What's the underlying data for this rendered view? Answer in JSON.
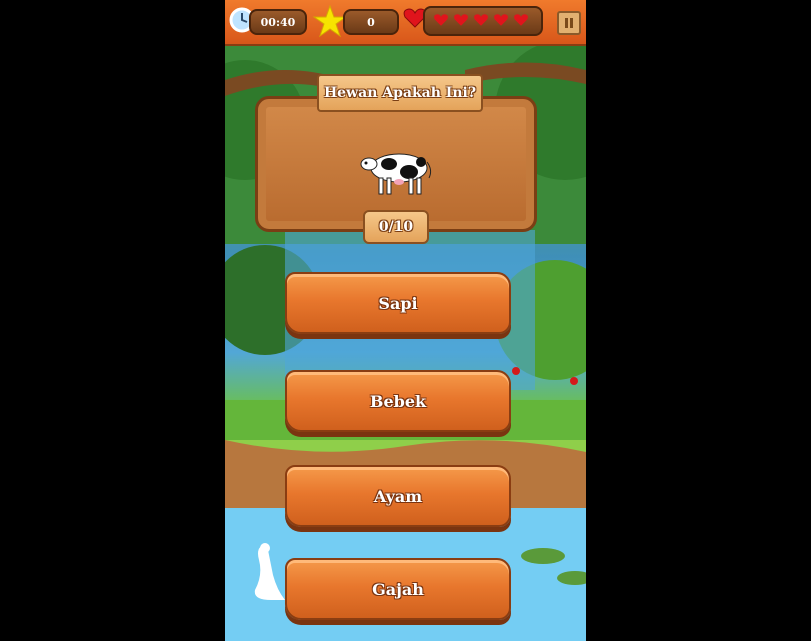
{
  "hud": {
    "timer": "00:40",
    "score": "0",
    "lives": 5,
    "pause_icon": "pause-icon"
  },
  "question": {
    "title": "Hewan Apakah Ini?",
    "image": "cow-image",
    "progress": "0/10"
  },
  "answers": [
    {
      "label": "Sapi"
    },
    {
      "label": "Bebek"
    },
    {
      "label": "Ayam"
    },
    {
      "label": "Gajah"
    }
  ],
  "colors": {
    "wood_orange": "#e8772d",
    "wood_dark": "#8a3d12",
    "heart_red": "#e0141c"
  }
}
